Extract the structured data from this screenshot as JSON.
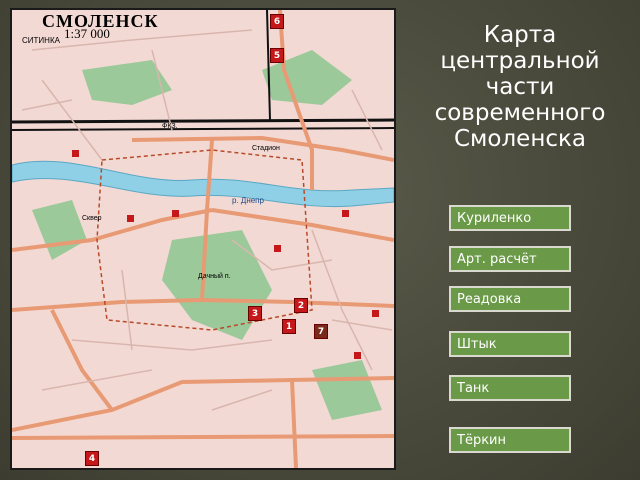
{
  "slide": {
    "title": "Карта центральной части современного Смоленска"
  },
  "map": {
    "title": "СМОЛЕНСК",
    "scale": "1:37 000",
    "corner_label": "СИТИНКА",
    "labels": {
      "rail_station": "ФКЗ.",
      "river": "р. Днепр",
      "park": "Дачный п.",
      "label_a": "Стадион",
      "label_b": "Сквер"
    },
    "markers": [
      "6",
      "5",
      "3",
      "2",
      "1",
      "7",
      "4"
    ],
    "colors": {
      "ground": "#f3d9d4",
      "road": "#e89a74",
      "river": "#8fd0e6",
      "green": "#9cc99a",
      "rail": "#111111",
      "marker": "#c4181a"
    }
  },
  "buttons": [
    {
      "label": "Куриленко"
    },
    {
      "label": "Арт. расчёт"
    },
    {
      "label": "Реадовка"
    },
    {
      "label": "Штык"
    },
    {
      "label": " Танк"
    },
    {
      "label": "Тёркин"
    }
  ],
  "button_color": "#6a9a48"
}
